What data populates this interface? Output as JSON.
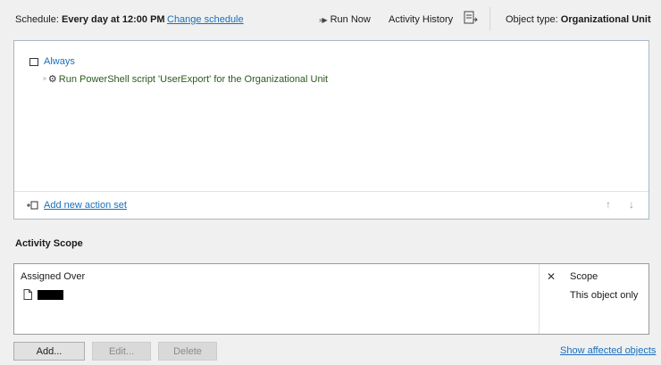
{
  "schedule": {
    "label": "Schedule:",
    "value": "Every day at 12:00 PM",
    "change_link": "Change schedule"
  },
  "toolbar": {
    "run_now": "Run Now",
    "activity_history": "Activity History",
    "object_type_label": "Object type:",
    "object_type_value": "Organizational Unit"
  },
  "actions": {
    "condition_label": "Always",
    "action_text": "Run PowerShell script 'UserExport' for the Organizational Unit",
    "add_action_set": "Add new action set"
  },
  "scope": {
    "title": "Activity Scope",
    "columns": {
      "assigned_over": "Assigned Over",
      "remove": "✕",
      "scope": "Scope"
    },
    "rows": [
      {
        "scope": "This object only"
      }
    ]
  },
  "buttons": {
    "add": "Add...",
    "edit": "Edit...",
    "delete": "Delete",
    "show_affected": "Show affected objects"
  },
  "colors": {
    "link": "#1a6fbd",
    "action_text": "#2c5a1e",
    "panel_border": "#a9b7c6",
    "background": "#f0f0f0"
  },
  "icons": [
    "run-icon",
    "export-icon",
    "checkbox-icon",
    "gear-icon",
    "add-action-set-icon",
    "arrow-up-icon",
    "arrow-down-icon",
    "document-icon"
  ]
}
